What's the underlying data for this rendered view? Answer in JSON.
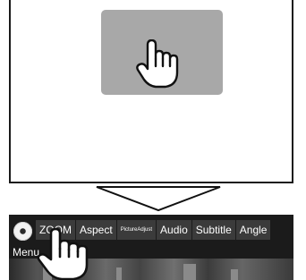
{
  "menu": {
    "items": [
      {
        "label": "ZOOM"
      },
      {
        "label": "Aspect"
      },
      {
        "label": "PictureAdjust"
      },
      {
        "label": "Audio"
      },
      {
        "label": "Subtitle"
      },
      {
        "label": "Angle"
      }
    ],
    "menu_label": "Menu"
  },
  "icons": {
    "disc": "disc-icon",
    "hand_pointer": "hand-pointer-icon",
    "arrow": "down-arrow-icon"
  },
  "colors": {
    "touch_area": "#a8a8a8",
    "menu_bar_bg": "#3b3b3b",
    "strip_bg": "#1b1b1b"
  }
}
